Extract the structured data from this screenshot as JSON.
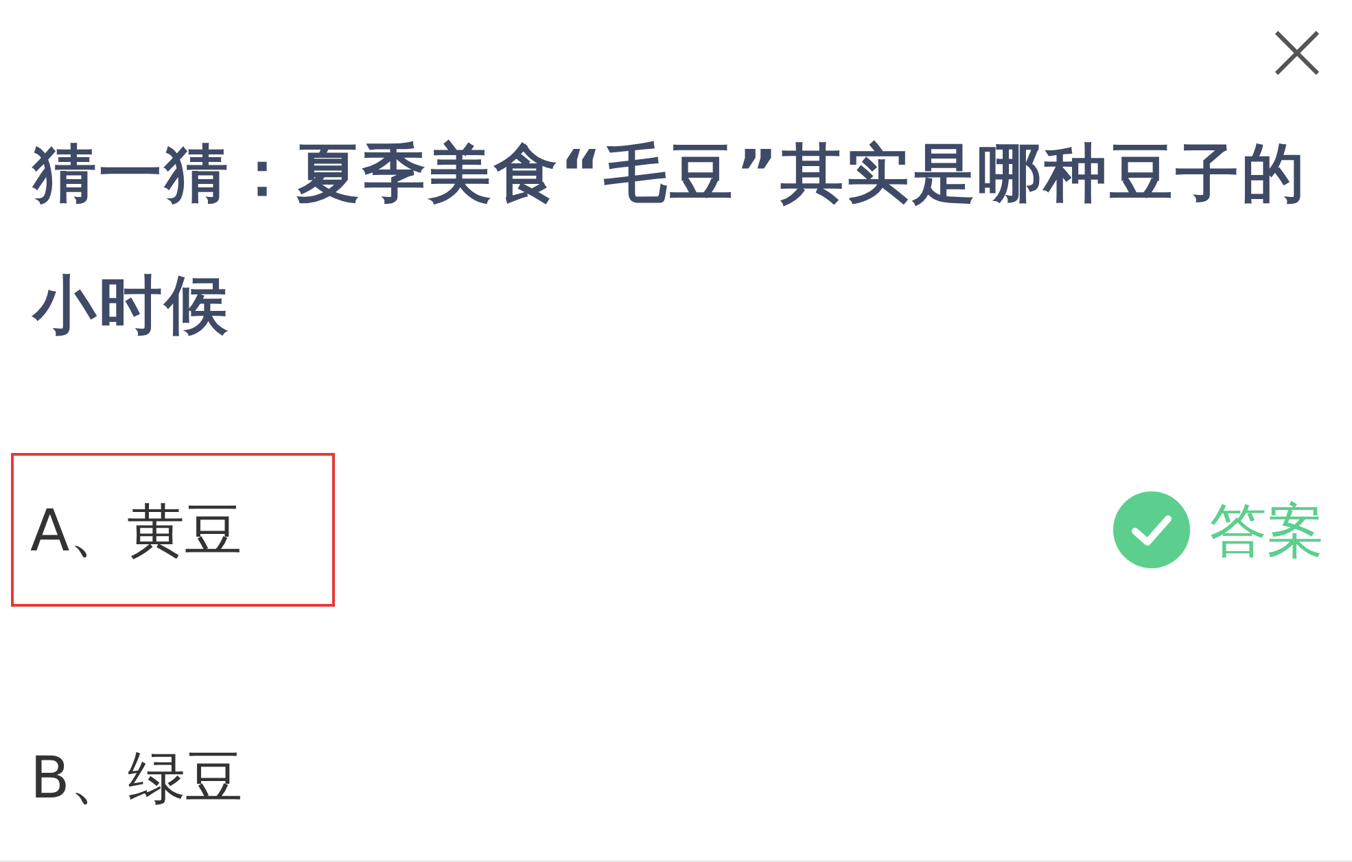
{
  "close_button": {
    "label": "×"
  },
  "question": "猜一猜：夏季美食“毛豆”其实是哪种豆子的小时候",
  "options": [
    {
      "label": "A、黄豆",
      "highlighted": true,
      "answer_tag": "答案"
    },
    {
      "label": "B、绿豆",
      "highlighted": false
    }
  ]
}
